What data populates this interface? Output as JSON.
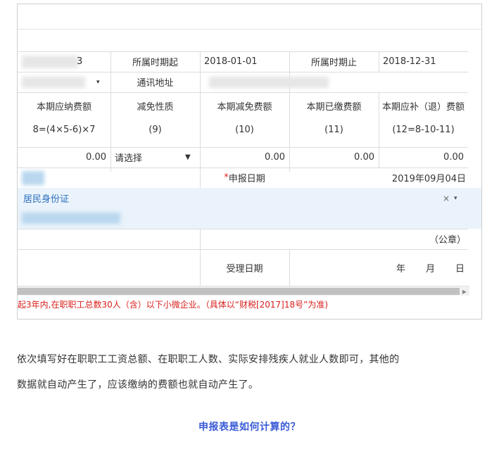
{
  "form": {
    "row1": {
      "partial_value": "3",
      "period_start_label": "所属时期起",
      "period_start_value": "2018-01-01",
      "period_end_label": "所属时期止",
      "period_end_value": "2018-12-31"
    },
    "row2": {
      "address_label": "通讯地址"
    },
    "headers": [
      {
        "title": "本期应纳费额",
        "formula": "8=(4×5-6)×7"
      },
      {
        "title": "减免性质",
        "formula": "(9)"
      },
      {
        "title": "本期减免费额",
        "formula": "(10)"
      },
      {
        "title": "本期已缴费额",
        "formula": "(11)"
      },
      {
        "title": "本期应补（退）费额",
        "formula": "(12=8-10-11)"
      }
    ],
    "values": {
      "payable": "0.00",
      "relief_select": "请选择",
      "relief_amount": "0.00",
      "paid_amount": "0.00",
      "due_amount": "0.00"
    },
    "declare_date_required": "*",
    "declare_date_label": "申报日期",
    "declare_date_value": "2019年09月04日",
    "id_type_value": "居民身份证",
    "id_type_clear": "×",
    "seal_label": "（公章）",
    "accept_date_label": "受理日期",
    "accept_year": "年",
    "accept_month": "月",
    "accept_day": "日",
    "footnote": "起3年内,在职职工总数30人（含）以下小微企业。（具体以“财税[2017]18号”为准)"
  },
  "article": {
    "paragraph_line1": "依次填写好在职职工工资总额、在职职工人数、实际安排残疾人就业人数即可，其他的",
    "paragraph_line2": "数据就自动产生了，应该缴纳的费额也就自动产生了。",
    "section_heading": "申报表是如何计算的？"
  },
  "colors": {
    "accent_blue": "#3a5bd6",
    "warning_red": "#e02020",
    "selected_band": "#eaf3fb"
  }
}
